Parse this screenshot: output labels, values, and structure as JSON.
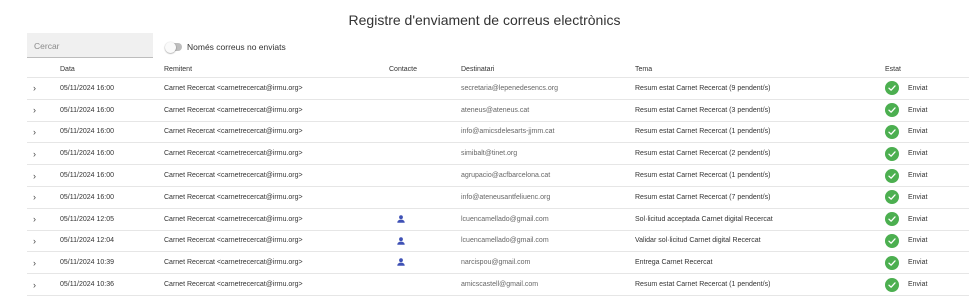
{
  "page": {
    "title": "Registre d'enviament de correus electrònics"
  },
  "search": {
    "placeholder": "Cercar"
  },
  "filter": {
    "toggle_label": "Només correus no enviats"
  },
  "table": {
    "headers": {
      "date": "Data",
      "from": "Remitent",
      "contact": "Contacte",
      "to": "Destinatari",
      "subject": "Tema",
      "status": "Estat"
    },
    "rows": [
      {
        "date": "05/11/2024 16:00",
        "from": "Carnet Recercat <carnetrecercat@irmu.org>",
        "contact": false,
        "to": "secretaria@lepenedesencs.org",
        "subject": "Resum estat Carnet Recercat (9 pendent/s)",
        "status": "Enviat"
      },
      {
        "date": "05/11/2024 16:00",
        "from": "Carnet Recercat <carnetrecercat@irmu.org>",
        "contact": false,
        "to": "ateneus@ateneus.cat",
        "subject": "Resum estat Carnet Recercat (3 pendent/s)",
        "status": "Enviat"
      },
      {
        "date": "05/11/2024 16:00",
        "from": "Carnet Recercat <carnetrecercat@irmu.org>",
        "contact": false,
        "to": "info@amicsdelesarts-jjmm.cat",
        "subject": "Resum estat Carnet Recercat (1 pendent/s)",
        "status": "Enviat"
      },
      {
        "date": "05/11/2024 16:00",
        "from": "Carnet Recercat <carnetrecercat@irmu.org>",
        "contact": false,
        "to": "simibalt@tinet.org",
        "subject": "Resum estat Carnet Recercat (2 pendent/s)",
        "status": "Enviat"
      },
      {
        "date": "05/11/2024 16:00",
        "from": "Carnet Recercat <carnetrecercat@irmu.org>",
        "contact": false,
        "to": "agrupacio@acfbarcelona.cat",
        "subject": "Resum estat Carnet Recercat (1 pendent/s)",
        "status": "Enviat"
      },
      {
        "date": "05/11/2024 16:00",
        "from": "Carnet Recercat <carnetrecercat@irmu.org>",
        "contact": false,
        "to": "info@ateneusantfeliuenc.org",
        "subject": "Resum estat Carnet Recercat (7 pendent/s)",
        "status": "Enviat"
      },
      {
        "date": "05/11/2024 12:05",
        "from": "Carnet Recercat <carnetrecercat@irmu.org>",
        "contact": true,
        "to": "lcuencamellado@gmail.com",
        "subject": "Sol·licitud acceptada Carnet digital Recercat",
        "status": "Enviat"
      },
      {
        "date": "05/11/2024 12:04",
        "from": "Carnet Recercat <carnetrecercat@irmu.org>",
        "contact": true,
        "to": "lcuencamellado@gmail.com",
        "subject": "Validar sol·licitud Carnet digital Recercat",
        "status": "Enviat"
      },
      {
        "date": "05/11/2024 10:39",
        "from": "Carnet Recercat <carnetrecercat@irmu.org>",
        "contact": true,
        "to": "narcispou@gmail.com",
        "subject": "Entrega Carnet Recercat",
        "status": "Enviat"
      },
      {
        "date": "05/11/2024 10:36",
        "from": "Carnet Recercat <carnetrecercat@irmu.org>",
        "contact": false,
        "to": "amicscastell@gmail.com",
        "subject": "Resum estat Carnet Recercat (1 pendent/s)",
        "status": "Enviat"
      }
    ]
  },
  "colors": {
    "status_ok": "#4caf50",
    "contact_icon": "#3f51b5",
    "toggle_track": "#bdbdbd"
  },
  "icons": {
    "expand": "chevron-right-icon",
    "contact": "person-icon",
    "status": "check-circle-icon"
  }
}
